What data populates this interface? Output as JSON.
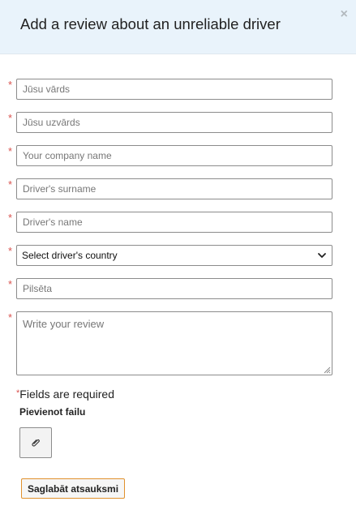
{
  "modal": {
    "title": "Add a review about an unreliable driver",
    "close_symbol": "×"
  },
  "form": {
    "required_mark": "*",
    "first_name": {
      "placeholder": "Jūsu vārds",
      "value": ""
    },
    "last_name": {
      "placeholder": "Jūsu uzvārds",
      "value": ""
    },
    "company_name": {
      "placeholder": "Your company name",
      "value": ""
    },
    "driver_surname": {
      "placeholder": "Driver's surname",
      "value": ""
    },
    "driver_name": {
      "placeholder": "Driver's name",
      "value": ""
    },
    "driver_country": {
      "selected": "Select driver's country"
    },
    "city": {
      "placeholder": "Pilsēta",
      "value": ""
    },
    "review": {
      "placeholder": "Write your review",
      "value": ""
    },
    "required_note": "Fields are required",
    "attach_label": "Pievienot failu",
    "save_label": "Saglabāt atsauksmi"
  },
  "icons": {
    "close": "close-icon",
    "select_arrow": "chevron-down-icon",
    "attach": "paperclip-icon"
  },
  "colors": {
    "header_background": "#e9f3fb",
    "required_star": "#d9534f",
    "save_button_border": "#e0912c"
  }
}
